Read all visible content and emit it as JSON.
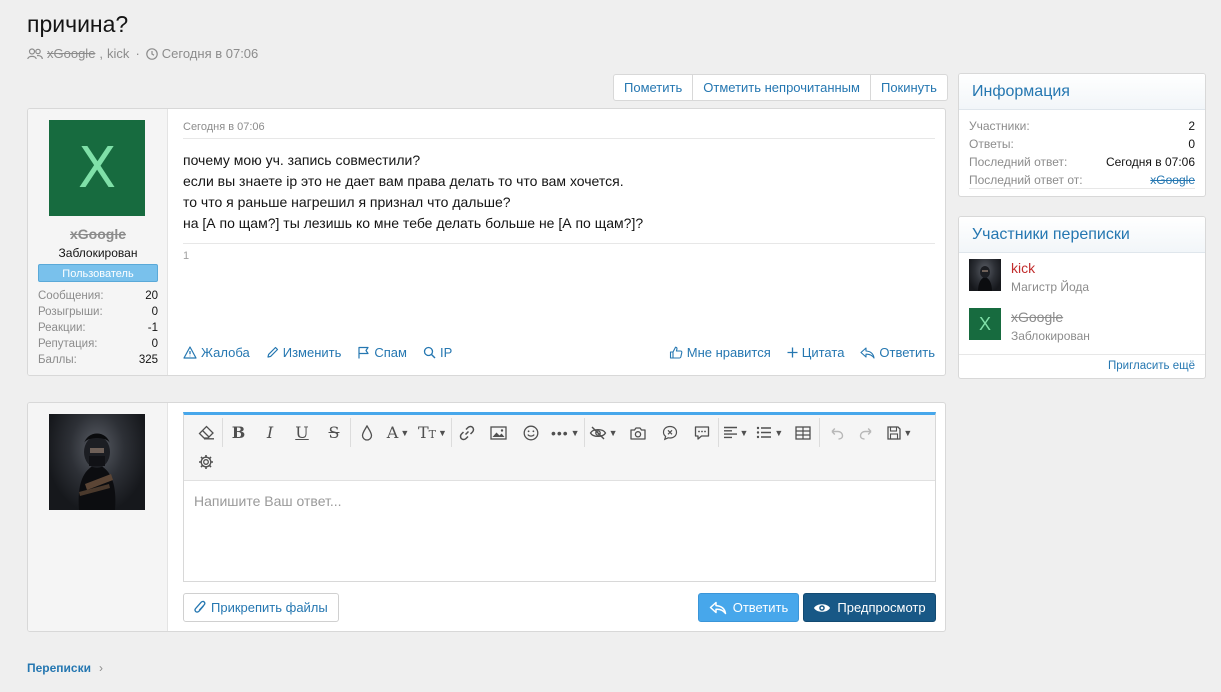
{
  "page": {
    "title": "причина?",
    "meta": {
      "participant_1": "xGoogle",
      "separator": ",",
      "participant_2": "kick",
      "date": "Сегодня в 07:06"
    }
  },
  "actions": [
    "Пометить",
    "Отметить непрочитанным",
    "Покинуть"
  ],
  "post": {
    "author": {
      "name": "xGoogle",
      "status": "Заблокирован",
      "banner": "Пользователь",
      "avatar_letter": "X",
      "stats": [
        {
          "label": "Сообщения:",
          "value": "20"
        },
        {
          "label": "Розыгрыши:",
          "value": "0"
        },
        {
          "label": "Реакции:",
          "value": "-1"
        },
        {
          "label": "Репутация:",
          "value": "0"
        },
        {
          "label": "Баллы:",
          "value": "325"
        }
      ]
    },
    "date": "Сегодня в 07:06",
    "lines": [
      "почему мою уч. запись совместили?",
      "если вы знаете ip это не дает вам права делать то что вам хочется.",
      "то что я раньше нагрешил я признал что дальше?",
      "на [А по щам?] ты лезишь ко мне тебе делать больше не [А по щам?]?"
    ],
    "counter": "1",
    "footer_left": [
      {
        "icon": "warning-icon",
        "label": "Жалоба"
      },
      {
        "icon": "pencil-icon",
        "label": "Изменить"
      },
      {
        "icon": "flag-icon",
        "label": "Спам"
      },
      {
        "icon": "search-icon",
        "label": "IP"
      }
    ],
    "footer_right": [
      {
        "icon": "thumbs-up-icon",
        "label": "Мне нравится"
      },
      {
        "icon": "plus-icon",
        "label": "Цитата"
      },
      {
        "icon": "reply-icon",
        "label": "Ответить"
      }
    ]
  },
  "reply": {
    "placeholder": "Напишите Ваш ответ...",
    "attach_label": "Прикрепить файлы",
    "reply_label": "Ответить",
    "preview_label": "Предпросмотр"
  },
  "sidebar": {
    "info": {
      "title": "Информация",
      "rows": [
        {
          "label": "Участники:",
          "value": "2"
        },
        {
          "label": "Ответы:",
          "value": "0"
        },
        {
          "label": "Последний ответ:",
          "value": "Сегодня в 07:06"
        },
        {
          "label": "Последний ответ от:",
          "value": "xGoogle"
        }
      ]
    },
    "participants": {
      "title": "Участники переписки",
      "members": [
        {
          "name": "kick",
          "status": "Магистр Йода",
          "name_color": "#c22d2d"
        },
        {
          "name": "xGoogle",
          "status": "Заблокирован",
          "avatar_letter": "X"
        }
      ],
      "invite": "Пригласить ещё"
    }
  },
  "breadcrumb": {
    "label": "Переписки",
    "chevron": "›"
  },
  "colors": {
    "accent": "#2577b1",
    "button_primary": "#185886",
    "button_secondary": "#47a7eb",
    "avatar_green": "#176b3f"
  }
}
